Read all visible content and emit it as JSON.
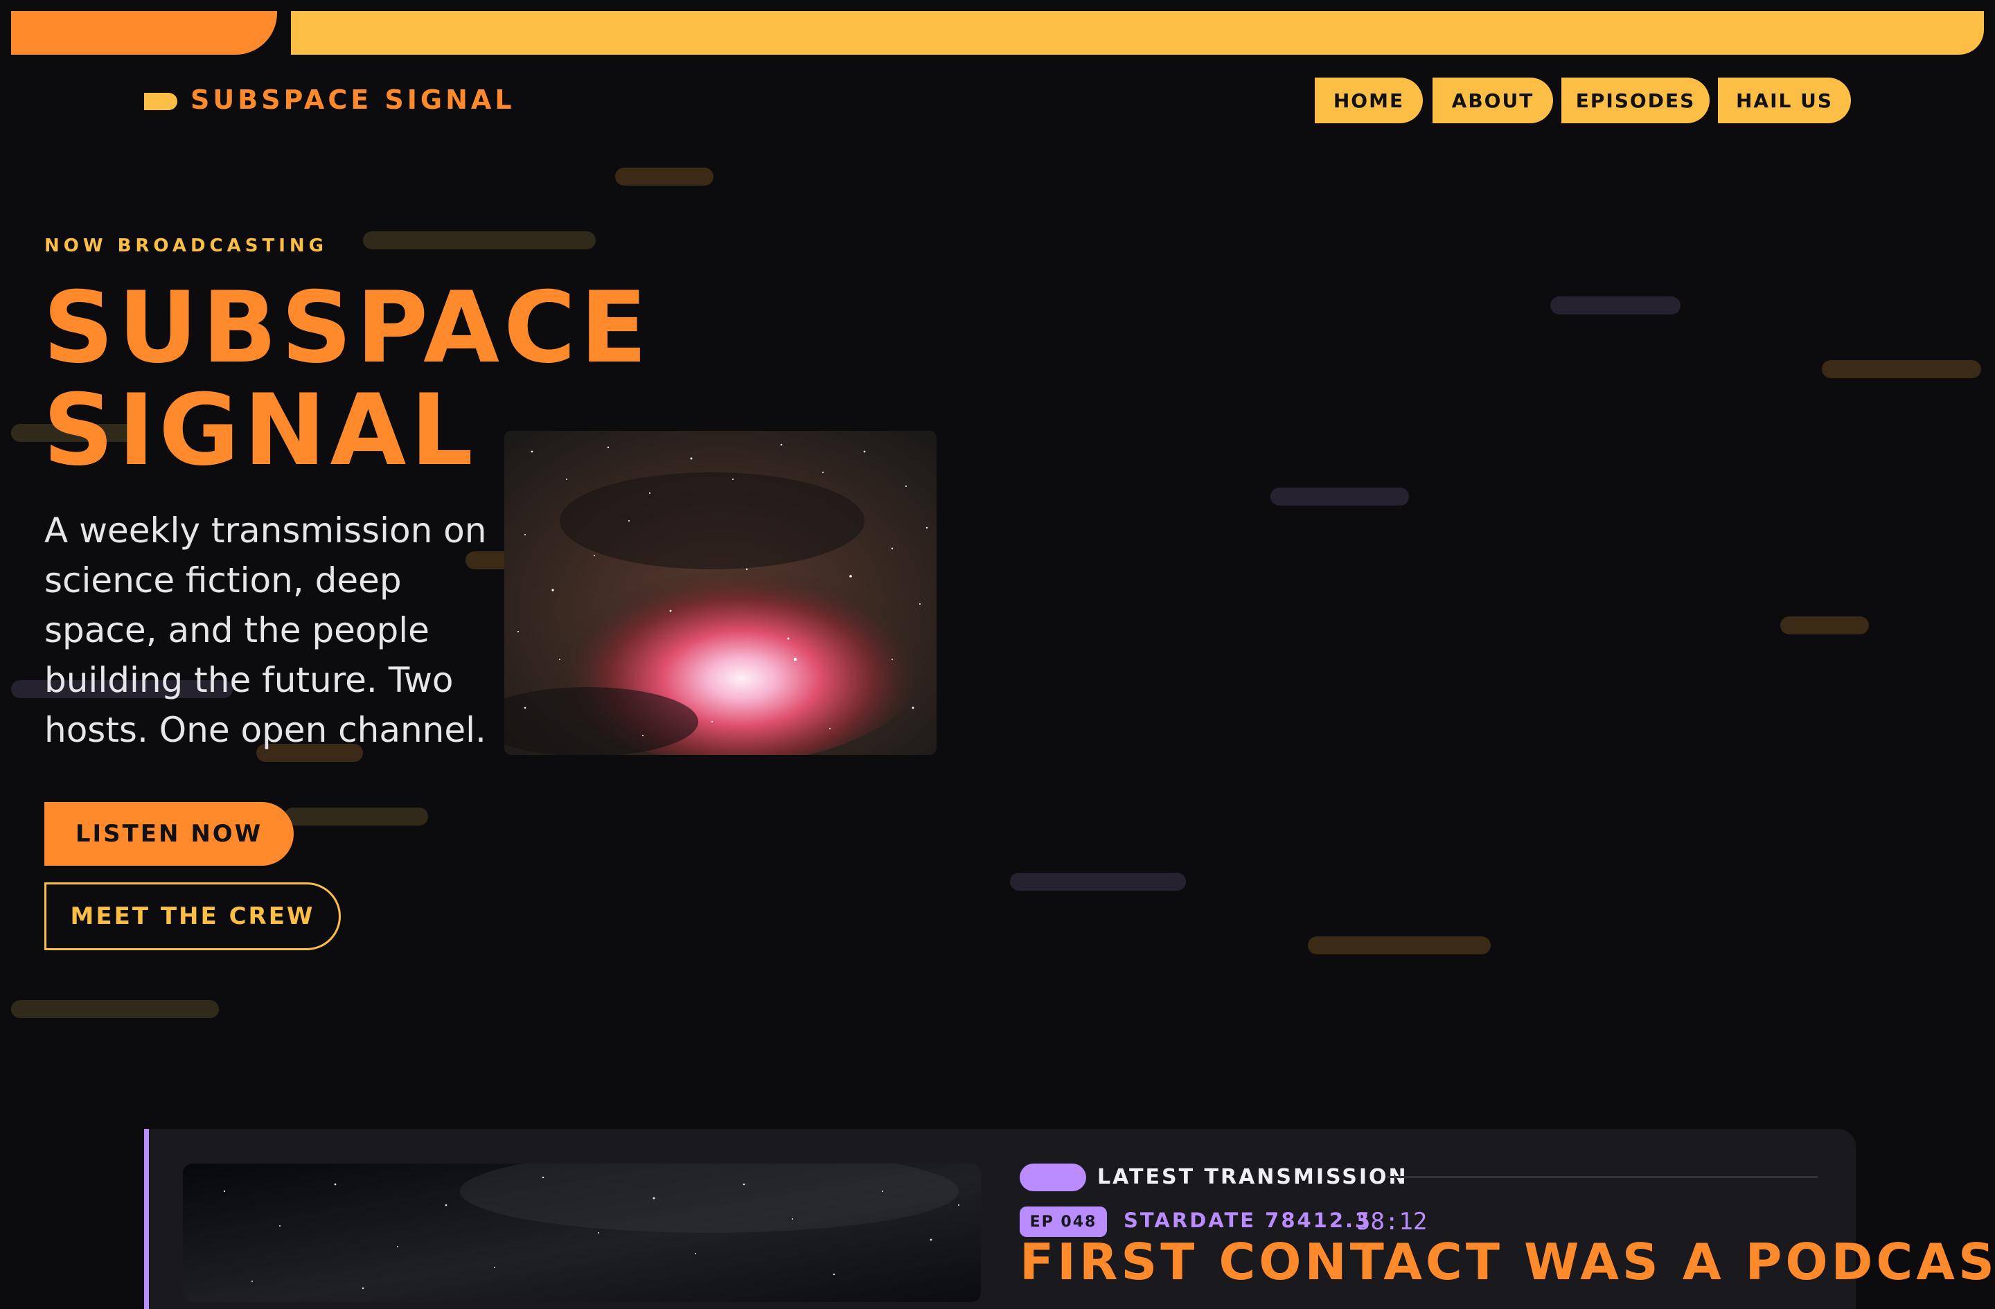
{
  "header": {
    "brand": "SUBSPACE SIGNAL",
    "nav": [
      "HOME",
      "ABOUT",
      "EPISODES",
      "HAIL US"
    ]
  },
  "hero": {
    "eyebrow": "NOW BROADCASTING",
    "title_line1": "SUBSPACE",
    "title_line2": "SIGNAL",
    "description": "A weekly transmission on science fiction, deep space, and the people building the future. Two hosts. One open channel.",
    "primary_cta": "LISTEN NOW",
    "secondary_cta": "MEET THE CREW"
  },
  "latest": {
    "kicker": "LATEST TRANSMISSION",
    "episode": "EP 048",
    "stardate": "STARDATE 78412.3",
    "duration": "58:12",
    "title": "FIRST CONTACT WAS A PODCAST"
  },
  "colors": {
    "orange": "#ff8a2b",
    "amber": "#fdbe46",
    "lavender": "#b98cff",
    "background": "#0c0c0e"
  }
}
